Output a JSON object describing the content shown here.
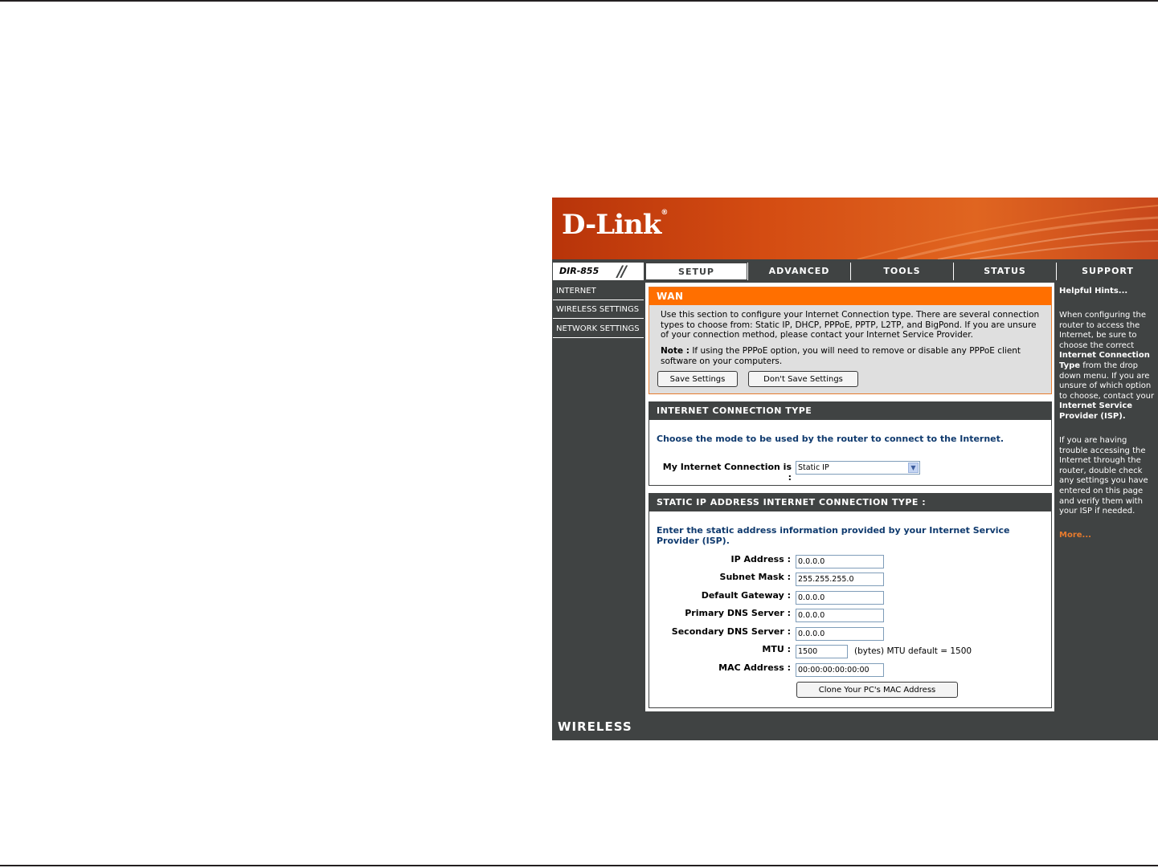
{
  "brand": {
    "logo": "D-Link",
    "model": "DIR-855"
  },
  "tabs": [
    "SETUP",
    "ADVANCED",
    "TOOLS",
    "STATUS",
    "SUPPORT"
  ],
  "nav": [
    "INTERNET",
    "WIRELESS SETTINGS",
    "NETWORK SETTINGS"
  ],
  "wan": {
    "title": "WAN",
    "description": "Use this section to configure your Internet Connection type. There are several connection types to choose from: Static IP, DHCP, PPPoE, PPTP, L2TP, and BigPond. If you are unsure of your connection method, please contact your Internet Service Provider.",
    "note_label": "Note :",
    "note_text": " If using the PPPoE option, you will need to remove or disable any PPPoE client software on your computers.",
    "save_label": "Save Settings",
    "dont_save_label": "Don't Save Settings"
  },
  "connection_type": {
    "title": "INTERNET CONNECTION TYPE",
    "intro": "Choose the mode to be used by the router to connect to the Internet.",
    "label": "My Internet Connection is :",
    "selected": "Static IP"
  },
  "static_ip": {
    "title": "STATIC IP ADDRESS INTERNET CONNECTION TYPE :",
    "intro": "Enter the static address information provided by your Internet Service Provider (ISP).",
    "fields": [
      {
        "label": "IP Address :",
        "value": "0.0.0.0"
      },
      {
        "label": "Subnet Mask :",
        "value": "255.255.255.0"
      },
      {
        "label": "Default Gateway :",
        "value": "0.0.0.0"
      },
      {
        "label": "Primary DNS Server :",
        "value": "0.0.0.0"
      },
      {
        "label": "Secondary DNS Server :",
        "value": "0.0.0.0"
      }
    ],
    "mtu_label": "MTU :",
    "mtu_value": "1500",
    "mtu_note": "(bytes) MTU default = 1500",
    "mac_label": "MAC Address :",
    "mac_value": "00:00:00:00:00:00",
    "clone_label": "Clone Your PC's MAC Address"
  },
  "hints": {
    "title": "Helpful Hints...",
    "p1_a": "When configuring the router to access the Internet, be sure to choose the correct ",
    "p1_b": "Internet Connection Type",
    "p1_c": " from the drop down menu. If you are unsure of which option to choose, contact your ",
    "p1_d": "Internet Service Provider (ISP).",
    "p2": "If you are having trouble accessing the Internet through the router, double check any settings you have entered on this page and verify them with your ISP if needed.",
    "more": "More..."
  },
  "footer": "WIRELESS",
  "colors": {
    "orange": "#ff6f00",
    "panel_gray": "#404343",
    "link_blue": "#0f3a6e"
  },
  "icons": {
    "select_arrow": "chevron-down-icon"
  }
}
